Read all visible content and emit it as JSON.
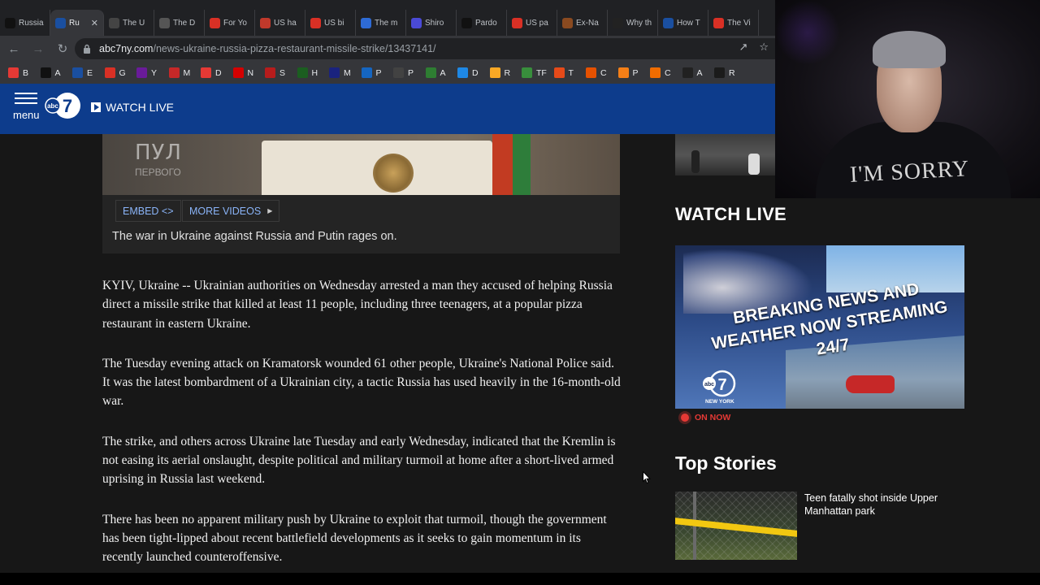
{
  "browser": {
    "tabs": [
      {
        "label": "Russia",
        "icon": "abc-icon",
        "color": "#111111",
        "active": false
      },
      {
        "label": "Ru",
        "icon": "abc7-icon",
        "color": "#1a4fa0",
        "active": true
      },
      {
        "label": "The U",
        "icon": "t-icon",
        "color": "#444444",
        "active": false
      },
      {
        "label": "The D",
        "icon": "d-icon",
        "color": "#555555",
        "active": false
      },
      {
        "label": "For Yo",
        "icon": "e-icon",
        "color": "#d93025",
        "active": false
      },
      {
        "label": "US ha",
        "icon": "news-icon",
        "color": "#c0392b",
        "active": false
      },
      {
        "label": "US bi",
        "icon": "g-icon",
        "color": "#d93025",
        "active": false
      },
      {
        "label": "The m",
        "icon": "d-icon",
        "color": "#2e6bd6",
        "active": false
      },
      {
        "label": "Shiro",
        "icon": "shield-icon",
        "color": "#4a4ad6",
        "active": false
      },
      {
        "label": "Pardo",
        "icon": "medium-icon",
        "color": "#111111",
        "active": false
      },
      {
        "label": "US pa",
        "icon": "g-icon",
        "color": "#d93025",
        "active": false
      },
      {
        "label": "Ex-Na",
        "icon": "ex-icon",
        "color": "#8a4a20",
        "active": false
      },
      {
        "label": "Why th",
        "icon": "s-icon",
        "color": "#222222",
        "active": false
      },
      {
        "label": "How T",
        "icon": "dots-icon",
        "color": "#1a4fa0",
        "active": false
      },
      {
        "label": "The Vi",
        "icon": "hat-icon",
        "color": "#d93025",
        "active": false
      }
    ],
    "url_host": "abc7ny.com",
    "url_path": "/news-ukraine-russia-pizza-restaurant-missile-strike/13437141/",
    "bookmarks": [
      {
        "label": "B",
        "color": "#e53935"
      },
      {
        "label": "A",
        "color": "#111111"
      },
      {
        "label": "E",
        "color": "#1a4fa0"
      },
      {
        "label": "G",
        "color": "#d93025"
      },
      {
        "label": "Y",
        "color": "#6a1b9a"
      },
      {
        "label": "M",
        "color": "#c62828"
      },
      {
        "label": "D",
        "color": "#e53935"
      },
      {
        "label": "N",
        "color": "#d50000"
      },
      {
        "label": "S",
        "color": "#b71c1c"
      },
      {
        "label": "H",
        "color": "#1b5e20"
      },
      {
        "label": "M",
        "color": "#1a237e"
      },
      {
        "label": "P",
        "color": "#1565c0"
      },
      {
        "label": "P",
        "color": "#424242"
      },
      {
        "label": "A",
        "color": "#2e7d32"
      },
      {
        "label": "D",
        "color": "#1e88e5"
      },
      {
        "label": "R",
        "color": "#f9a825"
      },
      {
        "label": "TF",
        "color": "#388e3c"
      },
      {
        "label": "T",
        "color": "#e64a19"
      },
      {
        "label": "C",
        "color": "#e65100"
      },
      {
        "label": "P",
        "color": "#f57f17"
      },
      {
        "label": "C",
        "color": "#ef6c00"
      },
      {
        "label": "A",
        "color": "#212121"
      },
      {
        "label": "R",
        "color": "#1b1b1b"
      }
    ]
  },
  "header": {
    "menu_label": "menu",
    "watch_live_label": "WATCH LIVE",
    "logo_text": "abc"
  },
  "video": {
    "overlay_title": "ПУЛ",
    "overlay_subtitle": "ПЕРВОГО",
    "embed_label": "EMBED <>",
    "more_videos_label": "MORE VIDEOS",
    "caption": "The war in Ukraine against Russia and Putin rages on."
  },
  "article": {
    "paragraphs": [
      "KYIV, Ukraine -- Ukrainian authorities on Wednesday arrested a man they accused of helping Russia direct a missile strike that killed at least 11 people, including three teenagers, at a popular pizza restaurant in eastern Ukraine.",
      "The Tuesday evening attack on Kramatorsk wounded 61 other people, Ukraine's National Police said. It was the latest bombardment of a Ukrainian city, a tactic Russia has used heavily in the 16-month-old war.",
      "The strike, and others across Ukraine late Tuesday and early Wednesday, indicated that the Kremlin is not easing its aerial onslaught, despite political and military turmoil at home after a short-lived armed uprising in Russia last weekend.",
      "There has been no apparent military push by Ukraine to exploit that turmoil, though the government has been tight-lipped about recent battlefield developments as it seeks to gain momentum in its recently launched counteroffensive."
    ]
  },
  "sidebar": {
    "watch_live_heading": "WATCH LIVE",
    "promo_text": "BREAKING NEWS AND WEATHER NOW STREAMING 24/7",
    "promo_logo_label": "NEW YORK",
    "on_now_label": "ON NOW",
    "top_stories_heading": "Top Stories",
    "stories": [
      {
        "title": "Teen fatally shot inside Upper Manhattan park"
      }
    ]
  },
  "webcam": {
    "shirt_text": "I'M SORRY"
  },
  "colors": {
    "header_blue": "#0d3c8c",
    "link_blue": "#8ab4f8",
    "live_red": "#e53935",
    "page_bg": "#171717"
  }
}
